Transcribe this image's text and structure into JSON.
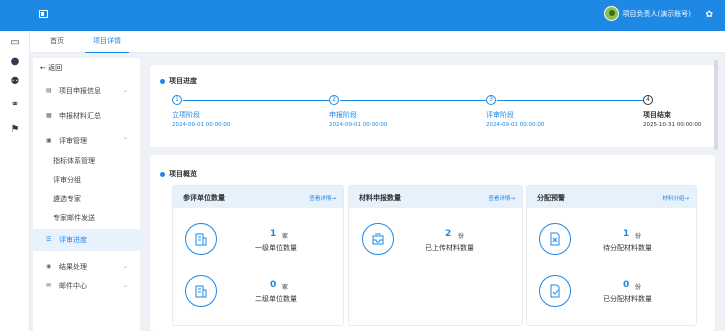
{
  "header": {
    "user_name": "项目负责人(演示账号)",
    "settings_icon": "gear-icon"
  },
  "rail": {
    "icons": [
      "monitor-icon",
      "user-icon",
      "group-icon",
      "link-icon",
      "flag-icon"
    ]
  },
  "tabs": [
    {
      "label": "首页"
    },
    {
      "label": "项目详情"
    }
  ],
  "sidebar": {
    "back_label": "返回",
    "items": [
      {
        "label": "项目申报信息"
      },
      {
        "label": "申报材料汇总"
      },
      {
        "label": "评审管理"
      },
      {
        "label": "指标体系管理"
      },
      {
        "label": "评审分组"
      },
      {
        "label": "遴选专家"
      },
      {
        "label": "专家邮件发送"
      },
      {
        "label": "评审进度"
      },
      {
        "label": "结果处理"
      },
      {
        "label": "邮件中心"
      }
    ]
  },
  "progress": {
    "title": "项目进度",
    "steps": [
      {
        "num": "1",
        "name": "立项阶段",
        "date": "2024-09-01 00:00:00"
      },
      {
        "num": "2",
        "name": "申报阶段",
        "date": "2024-09-01 00:00:00"
      },
      {
        "num": "3",
        "name": "评审阶段",
        "date": "2024-09-01 00:00:00"
      },
      {
        "num": "4",
        "name": "项目结束",
        "date": "2025-10-31 00:00:00"
      }
    ]
  },
  "overview": {
    "title": "项目概览",
    "panels": [
      {
        "title": "参评单位数量",
        "link": "查看详情→",
        "stats": [
          {
            "num": "1",
            "unit": "家",
            "label": "一级单位数量"
          },
          {
            "num": "0",
            "unit": "家",
            "label": "二级单位数量"
          }
        ]
      },
      {
        "title": "材料申报数量",
        "link": "查看详情→",
        "stats": [
          {
            "num": "2",
            "unit": "份",
            "label": "已上传材料数量"
          }
        ]
      },
      {
        "title": "分配预警",
        "link": "材料分组→",
        "stats": [
          {
            "num": "1",
            "unit": "份",
            "label": "待分配材料数量"
          },
          {
            "num": "0",
            "unit": "份",
            "label": "已分配材料数量"
          }
        ]
      }
    ]
  },
  "colors": {
    "accent": "#1e88e5",
    "panel_head": "#e6f1fc"
  }
}
